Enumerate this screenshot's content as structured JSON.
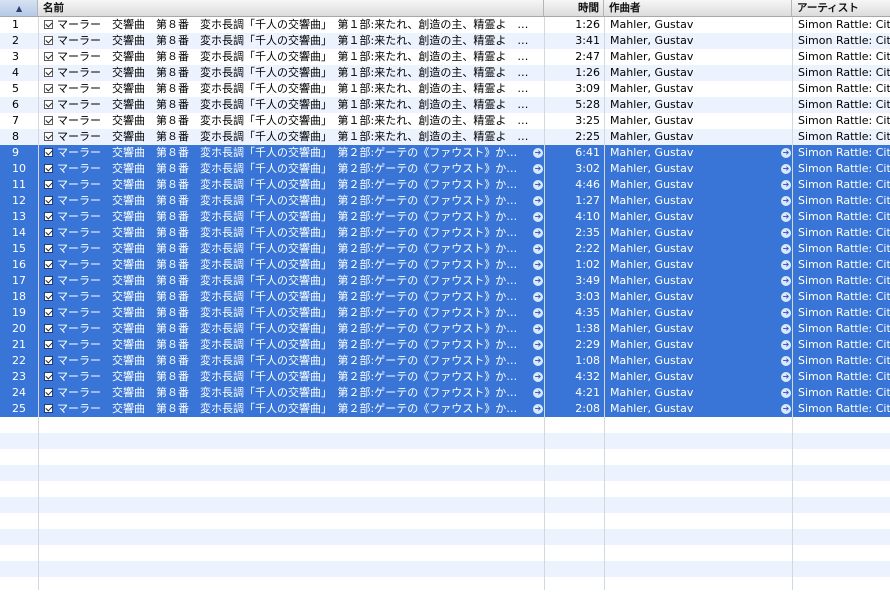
{
  "header": {
    "sort_arrow": "▲",
    "name": "名前",
    "time": "時間",
    "composer": "作曲者",
    "artist": "アーティスト"
  },
  "tracks": [
    {
      "num": "1",
      "name": "マーラー　交響曲　第８番　変ホ長調「千人の交響曲」　第１部:来たれ、創造の主、精霊よ　…",
      "time": "1:26",
      "composer": "Mahler, Gustav",
      "artist": "Simon Rattle: City of Birmingham Symphony Orchestra"
    },
    {
      "num": "2",
      "name": "マーラー　交響曲　第８番　変ホ長調「千人の交響曲」　第１部:来たれ、創造の主、精霊よ　…",
      "time": "3:41",
      "composer": "Mahler, Gustav",
      "artist": "Simon Rattle: City of Birmingham Symphony Orchestra"
    },
    {
      "num": "3",
      "name": "マーラー　交響曲　第８番　変ホ長調「千人の交響曲」　第１部:来たれ、創造の主、精霊よ　…",
      "time": "2:47",
      "composer": "Mahler, Gustav",
      "artist": "Simon Rattle: City of Birmingham Symphony Orchestra"
    },
    {
      "num": "4",
      "name": "マーラー　交響曲　第８番　変ホ長調「千人の交響曲」　第１部:来たれ、創造の主、精霊よ　…",
      "time": "1:26",
      "composer": "Mahler, Gustav",
      "artist": "Simon Rattle: City of Birmingham Symphony Orchestra"
    },
    {
      "num": "5",
      "name": "マーラー　交響曲　第８番　変ホ長調「千人の交響曲」　第１部:来たれ、創造の主、精霊よ　…",
      "time": "3:09",
      "composer": "Mahler, Gustav",
      "artist": "Simon Rattle: City of Birmingham Symphony Orchestra"
    },
    {
      "num": "6",
      "name": "マーラー　交響曲　第８番　変ホ長調「千人の交響曲」　第１部:来たれ、創造の主、精霊よ　…",
      "time": "5:28",
      "composer": "Mahler, Gustav",
      "artist": "Simon Rattle: City of Birmingham Symphony Orchestra"
    },
    {
      "num": "7",
      "name": "マーラー　交響曲　第８番　変ホ長調「千人の交響曲」　第１部:来たれ、創造の主、精霊よ　…",
      "time": "3:25",
      "composer": "Mahler, Gustav",
      "artist": "Simon Rattle: City of Birmingham Symphony Orchestra"
    },
    {
      "num": "8",
      "name": "マーラー　交響曲　第８番　変ホ長調「千人の交響曲」　第１部:来たれ、創造の主、精霊よ　…",
      "time": "2:25",
      "composer": "Mahler, Gustav",
      "artist": "Simon Rattle: City of Birmingham Symphony Orchestra"
    },
    {
      "num": "9",
      "name": "マーラー　交響曲　第８番　変ホ長調「千人の交響曲」　第２部:ゲーテの《ファウスト》か…",
      "time": "6:41",
      "composer": "Mahler, Gustav",
      "artist": "Simon Rattle: City of Birmingham Symphony Orchestra",
      "selected": true
    },
    {
      "num": "10",
      "name": "マーラー　交響曲　第８番　変ホ長調「千人の交響曲」　第２部:ゲーテの《ファウスト》か…",
      "time": "3:02",
      "composer": "Mahler, Gustav",
      "artist": "Simon Rattle: City of Birmingham Symphony Orchestra",
      "selected": true
    },
    {
      "num": "11",
      "name": "マーラー　交響曲　第８番　変ホ長調「千人の交響曲」　第２部:ゲーテの《ファウスト》か…",
      "time": "4:46",
      "composer": "Mahler, Gustav",
      "artist": "Simon Rattle: City of Birmingham Symphony Orchestra",
      "selected": true
    },
    {
      "num": "12",
      "name": "マーラー　交響曲　第８番　変ホ長調「千人の交響曲」　第２部:ゲーテの《ファウスト》か…",
      "time": "1:27",
      "composer": "Mahler, Gustav",
      "artist": "Simon Rattle: City of Birmingham Symphony Orchestra",
      "selected": true
    },
    {
      "num": "13",
      "name": "マーラー　交響曲　第８番　変ホ長調「千人の交響曲」　第２部:ゲーテの《ファウスト》か…",
      "time": "4:10",
      "composer": "Mahler, Gustav",
      "artist": "Simon Rattle: City of Birmingham Symphony Orchestra",
      "selected": true
    },
    {
      "num": "14",
      "name": "マーラー　交響曲　第８番　変ホ長調「千人の交響曲」　第２部:ゲーテの《ファウスト》か…",
      "time": "2:35",
      "composer": "Mahler, Gustav",
      "artist": "Simon Rattle: City of Birmingham Symphony Orchestra",
      "selected": true
    },
    {
      "num": "15",
      "name": "マーラー　交響曲　第８番　変ホ長調「千人の交響曲」　第２部:ゲーテの《ファウスト》か…",
      "time": "2:22",
      "composer": "Mahler, Gustav",
      "artist": "Simon Rattle: City of Birmingham Symphony Orchestra",
      "selected": true
    },
    {
      "num": "16",
      "name": "マーラー　交響曲　第８番　変ホ長調「千人の交響曲」　第２部:ゲーテの《ファウスト》か…",
      "time": "1:02",
      "composer": "Mahler, Gustav",
      "artist": "Simon Rattle: City of Birmingham Symphony Orchestra",
      "selected": true
    },
    {
      "num": "17",
      "name": "マーラー　交響曲　第８番　変ホ長調「千人の交響曲」　第２部:ゲーテの《ファウスト》か…",
      "time": "3:49",
      "composer": "Mahler, Gustav",
      "artist": "Simon Rattle: City of Birmingham Symphony Orchestra",
      "selected": true
    },
    {
      "num": "18",
      "name": "マーラー　交響曲　第８番　変ホ長調「千人の交響曲」　第２部:ゲーテの《ファウスト》か…",
      "time": "3:03",
      "composer": "Mahler, Gustav",
      "artist": "Simon Rattle: City of Birmingham Symphony Orchestra",
      "selected": true
    },
    {
      "num": "19",
      "name": "マーラー　交響曲　第８番　変ホ長調「千人の交響曲」　第２部:ゲーテの《ファウスト》か…",
      "time": "4:35",
      "composer": "Mahler, Gustav",
      "artist": "Simon Rattle: City of Birmingham Symphony Orchestra",
      "selected": true
    },
    {
      "num": "20",
      "name": "マーラー　交響曲　第８番　変ホ長調「千人の交響曲」　第２部:ゲーテの《ファウスト》か…",
      "time": "1:38",
      "composer": "Mahler, Gustav",
      "artist": "Simon Rattle: City of Birmingham Symphony Orchestra",
      "selected": true
    },
    {
      "num": "21",
      "name": "マーラー　交響曲　第８番　変ホ長調「千人の交響曲」　第２部:ゲーテの《ファウスト》か…",
      "time": "2:29",
      "composer": "Mahler, Gustav",
      "artist": "Simon Rattle: City of Birmingham Symphony Orchestra",
      "selected": true
    },
    {
      "num": "22",
      "name": "マーラー　交響曲　第８番　変ホ長調「千人の交響曲」　第２部:ゲーテの《ファウスト》か…",
      "time": "1:08",
      "composer": "Mahler, Gustav",
      "artist": "Simon Rattle: City of Birmingham Symphony Orchestra",
      "selected": true
    },
    {
      "num": "23",
      "name": "マーラー　交響曲　第８番　変ホ長調「千人の交響曲」　第２部:ゲーテの《ファウスト》か…",
      "time": "4:32",
      "composer": "Mahler, Gustav",
      "artist": "Simon Rattle: City of Birmingham Symphony Orchestra",
      "selected": true
    },
    {
      "num": "24",
      "name": "マーラー　交響曲　第８番　変ホ長調「千人の交響曲」　第２部:ゲーテの《ファウスト》か…",
      "time": "4:21",
      "composer": "Mahler, Gustav",
      "artist": "Simon Rattle: City of Birmingham Symphony Orchestra",
      "selected": true
    },
    {
      "num": "25",
      "name": "マーラー　交響曲　第８番　変ホ長調「千人の交響曲」　第２部:ゲーテの《ファウスト》か…",
      "time": "2:08",
      "composer": "Mahler, Gustav",
      "artist": "Simon Rattle: City of Birmingham Symphony Orchestra",
      "selected": true
    }
  ],
  "colors": {
    "selection": "#3875d7",
    "stripe": "#edf3fe"
  },
  "icons": {
    "go_arrow": "arrow-circle-right-icon",
    "checkbox": "checkbox-checked-icon"
  }
}
